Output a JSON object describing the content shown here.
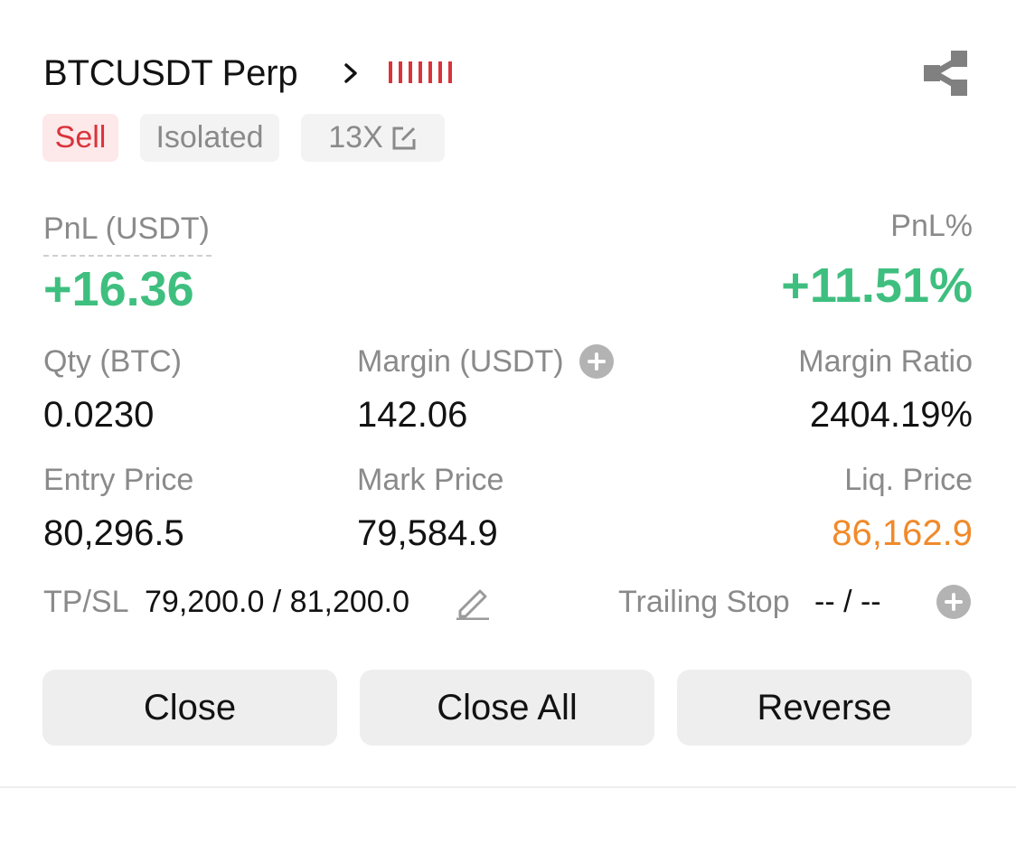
{
  "position": {
    "symbol": "BTCUSDT Perp",
    "side": "Sell",
    "margin_mode": "Isolated",
    "leverage": "13X"
  },
  "pnl": {
    "label": "PnL (USDT)",
    "value": "+16.36",
    "pct_label": "PnL%",
    "pct_value": "+11.51%"
  },
  "stats": {
    "qty_label": "Qty (BTC)",
    "qty_value": "0.0230",
    "margin_label": "Margin (USDT)",
    "margin_value": "142.06",
    "margin_ratio_label": "Margin Ratio",
    "margin_ratio_value": "2404.19%",
    "entry_label": "Entry Price",
    "entry_value": "80,296.5",
    "mark_label": "Mark Price",
    "mark_value": "79,584.9",
    "liq_label": "Liq. Price",
    "liq_value": "86,162.9"
  },
  "tpsl": {
    "label": "TP/SL",
    "value": "79,200.0 / 81,200.0",
    "trailing_label": "Trailing Stop",
    "trailing_value": "-- / --"
  },
  "actions": {
    "close": "Close",
    "close_all": "Close All",
    "reverse": "Reverse"
  },
  "colors": {
    "profit": "#3fbf7f",
    "sell": "#d9343a",
    "liquidation": "#f08a2a",
    "muted": "#8a8a8a"
  },
  "icons": [
    "chevron-right-icon",
    "strength-bars-icon",
    "share-icon",
    "edit-icon",
    "plus-circle-icon",
    "pencil-icon"
  ]
}
